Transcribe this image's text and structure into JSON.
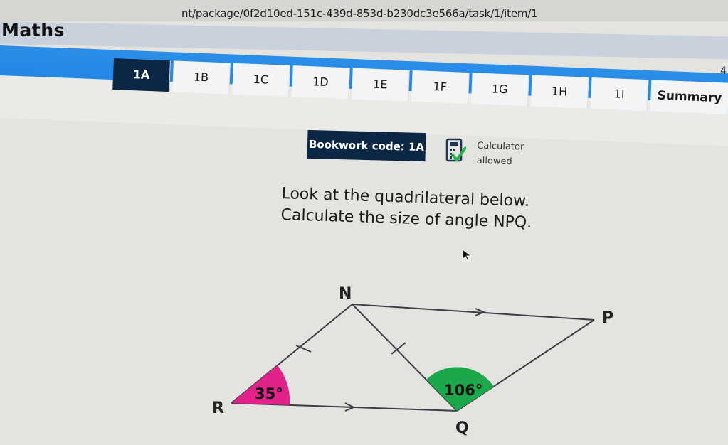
{
  "browser": {
    "url": "nt/package/0f2d10ed-151c-439d-853d-b230dc3e566a/task/1/item/1"
  },
  "app": {
    "title": "Maths",
    "right_marker": "4"
  },
  "tabs": [
    {
      "label": "1A",
      "active": true
    },
    {
      "label": "1B",
      "active": false
    },
    {
      "label": "1C",
      "active": false
    },
    {
      "label": "1D",
      "active": false
    },
    {
      "label": "1E",
      "active": false
    },
    {
      "label": "1F",
      "active": false
    },
    {
      "label": "1G",
      "active": false
    },
    {
      "label": "1H",
      "active": false
    },
    {
      "label": "1I",
      "active": false
    },
    {
      "label": "Summary",
      "active": false
    }
  ],
  "task": {
    "bookwork_code": "Bookwork code: 1A",
    "calculator_line1": "Calculator",
    "calculator_line2": "allowed",
    "question_line1": "Look at the quadrilateral below.",
    "question_line2": "Calculate the size of angle NPQ."
  },
  "diagram": {
    "vertex_labels": {
      "N": "N",
      "P": "P",
      "R": "R",
      "Q": "Q"
    },
    "angle_R": "35°",
    "angle_Q": "106°",
    "angle_colors": {
      "R": "#e2218a",
      "Q": "#1ca84a"
    }
  },
  "colors": {
    "tab_active_bg": "#0c2746",
    "band": "#1a83e1",
    "calc_check": "#2bb24c"
  },
  "icons": {
    "calculator": "calculator-check-icon",
    "cursor": "mouse-pointer-icon"
  }
}
